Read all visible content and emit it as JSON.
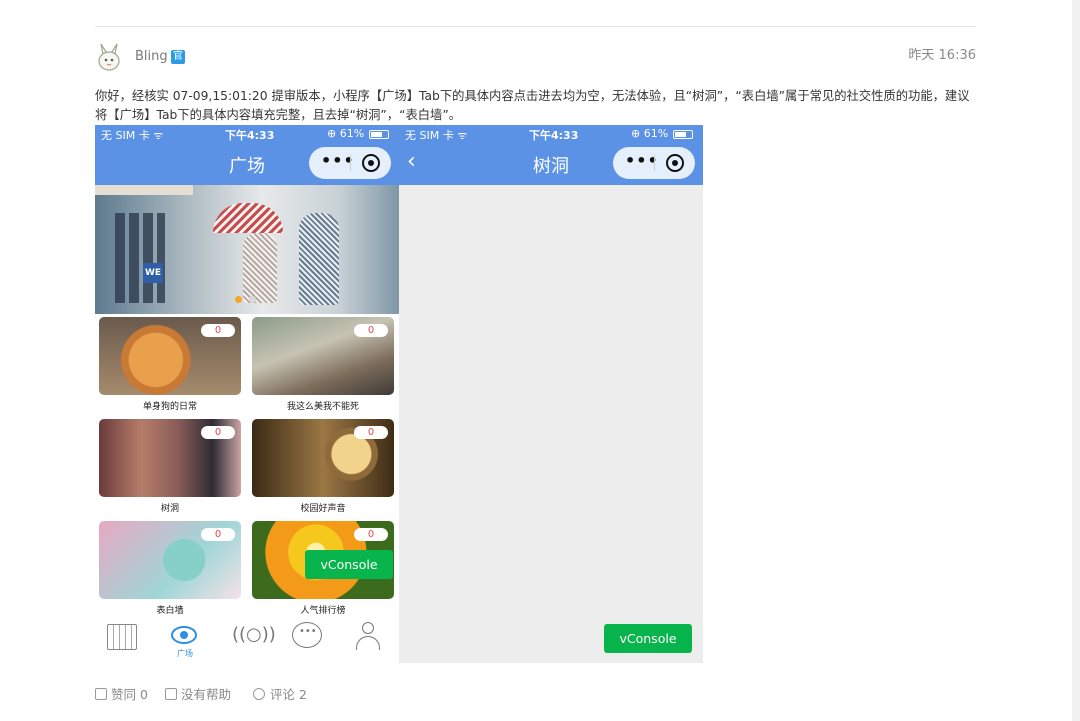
{
  "post": {
    "username": "Bling",
    "badge": "官",
    "timestamp": "昨天 16:36",
    "message": "你好，经核实 07-09,15:01:20 提审版本，小程序【广场】Tab下的具体内容点击进去均为空，无法体验，且“树洞”，“表白墙”属于常见的社交性质的功能，建议将【广场】Tab下的具体内容填充完整，且去掉“树洞”，“表白墙”。"
  },
  "left_phone": {
    "carrier": "无 SIM 卡 ᯤ",
    "clock": "下午4:33",
    "battery_text": "⊕ 61%",
    "title": "广场",
    "capsule_dots": "•••",
    "cards": [
      {
        "label": "单身狗的日常",
        "count": "0",
        "thumb": "dog-photo"
      },
      {
        "label": "我这么美我不能死",
        "count": "0",
        "thumb": "railway-photo"
      },
      {
        "label": "树洞",
        "count": "0",
        "thumb": "anime-photo"
      },
      {
        "label": "校园好声音",
        "count": "0",
        "thumb": "microphone-photo"
      },
      {
        "label": "表白墙",
        "count": "0",
        "thumb": "love-photo"
      },
      {
        "label": "人气排行榜",
        "count": "0",
        "thumb": "sunset-photo"
      }
    ],
    "banner_text": "WE",
    "tabbar_active_label": "广场",
    "tab_icons": [
      "calendar-icon",
      "eye-icon",
      "radio-icon",
      "chat-icon",
      "user-icon"
    ],
    "vconsole": "vConsole"
  },
  "right_phone": {
    "carrier": "无 SIM 卡 ᯤ",
    "clock": "下午4:33",
    "battery_text": "⊕ 61%",
    "title": "树洞",
    "back": "‹",
    "capsule_dots": "•••",
    "vconsole": "vConsole"
  },
  "footer": {
    "like": "赞同 0",
    "unhelpful": "没有帮助",
    "comments": "评论 2"
  },
  "colors": {
    "navbar": "#5b92e6",
    "accent": "#2f8ee5",
    "vconsole": "#08b44c",
    "count": "#e04a4a"
  }
}
